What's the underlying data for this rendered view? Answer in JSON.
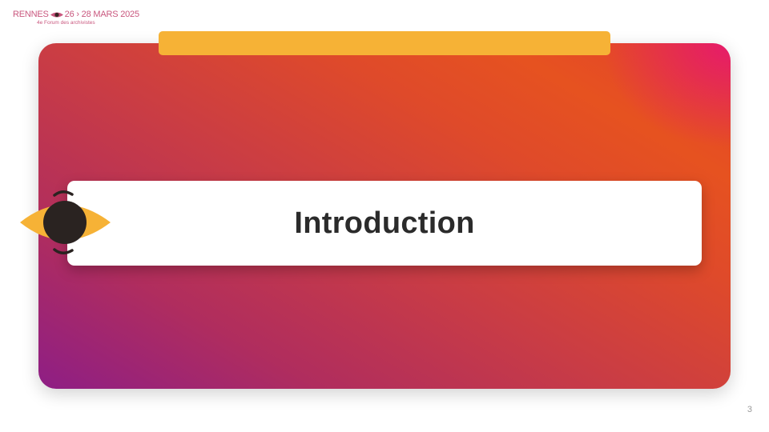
{
  "header": {
    "logo_line1_city": "RENNES",
    "logo_line1_dates": "26 › 28 MARS 2025",
    "logo_line2": "4e Forum des archivistes",
    "logo_color": "#c9577e",
    "eye_icon": "eye-icon"
  },
  "slide": {
    "title": "Introduction",
    "page_number": "3",
    "colors": {
      "bar": "#f6b236",
      "gradient_start": "#8e1e85",
      "gradient_mid": "#c93c45",
      "gradient_end": "#e65220",
      "corner_accent": "#e6196e",
      "eye_iris": "#2a2321",
      "eye_shape": "#f6b236",
      "title_text": "#2b2b2b"
    }
  }
}
